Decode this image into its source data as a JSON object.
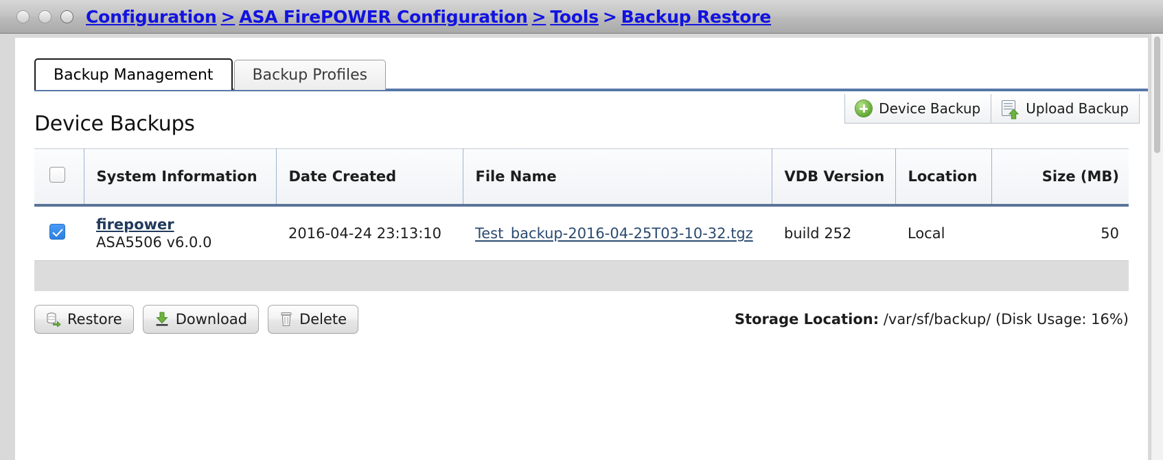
{
  "window": {
    "traffic_lights": [
      "close",
      "minimize",
      "zoom"
    ],
    "breadcrumb": {
      "segment1": "Configuration",
      "sep1": ">",
      "segment2": "ASA FirePOWER Configuration",
      "sep2": ">",
      "segment3": "Tools",
      "sep3": ">",
      "segment4": "Backup Restore",
      "full": "Configuration > ASA FirePOWER Configuration > Tools > Backup Restore",
      "link_color": "#1212e0"
    }
  },
  "tabs": [
    {
      "label": "Backup Management",
      "active": true
    },
    {
      "label": "Backup Profiles",
      "active": false
    }
  ],
  "toolbar": {
    "device_backup_label": "Device Backup",
    "device_backup_icon": "plus-circle-icon",
    "upload_backup_label": "Upload Backup",
    "upload_backup_icon": "upload-document-icon",
    "accent_color": "#5677a8"
  },
  "section": {
    "title": "Device Backups"
  },
  "table": {
    "columns": [
      {
        "key": "select",
        "label": ""
      },
      {
        "key": "system_information",
        "label": "System Information"
      },
      {
        "key": "date_created",
        "label": "Date Created"
      },
      {
        "key": "file_name",
        "label": "File Name"
      },
      {
        "key": "vdb_version",
        "label": "VDB Version"
      },
      {
        "key": "location",
        "label": "Location"
      },
      {
        "key": "size_mb",
        "label": "Size (MB)"
      }
    ],
    "header_checkbox_checked": false,
    "rows": [
      {
        "selected": true,
        "device_name": "firepower",
        "device_model": "ASA5506 v6.0.0",
        "date_created": "2016-04-24 23:13:10",
        "file_name": "Test_backup-2016-04-25T03-10-32.tgz",
        "vdb_version": "build 252",
        "location": "Local",
        "size_mb": "50"
      }
    ]
  },
  "actions": {
    "restore_label": "Restore",
    "restore_icon": "database-restore-icon",
    "download_label": "Download",
    "download_icon": "download-arrow-icon",
    "delete_label": "Delete",
    "delete_icon": "trash-icon"
  },
  "storage": {
    "label": "Storage Location:",
    "path": "/var/sf/backup/",
    "disk_usage": "(Disk Usage: 16%)"
  }
}
